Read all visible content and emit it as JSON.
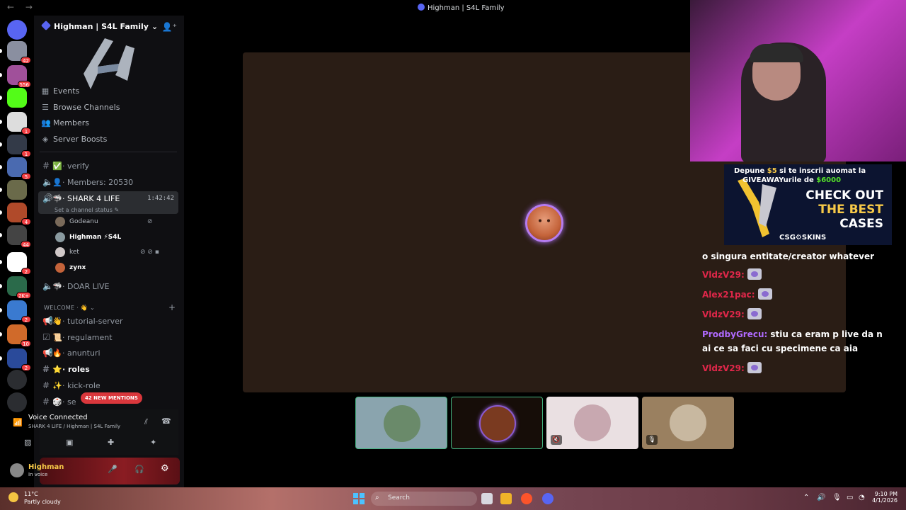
{
  "window": {
    "title": "Highman | S4L Family",
    "nav": "←  →"
  },
  "rail": {
    "servers": [
      {
        "name": "discord-home",
        "color": "#5865f2"
      },
      {
        "name": "s4l",
        "color": "#8a8fa0",
        "badge": "42"
      },
      {
        "name": "server-556",
        "color": "#a0509a",
        "badge": "556"
      },
      {
        "name": "kick",
        "color": "#53fc18"
      },
      {
        "name": "server-c",
        "color": "#dddddd",
        "badge": "1"
      },
      {
        "name": "csgo-skins",
        "color": "#333a48",
        "badge": "1"
      },
      {
        "name": "server-6",
        "color": "#4a6ab0",
        "badge": "5"
      },
      {
        "name": "server-7",
        "color": "#6a6a4a"
      },
      {
        "name": "server-8",
        "color": "#b04a2a",
        "badge": "4"
      },
      {
        "name": "server-9",
        "color": "#444444",
        "badge": "44"
      },
      {
        "name": "server-w",
        "color": "#ffffff",
        "badge": "2"
      },
      {
        "name": "server-11",
        "color": "#2a6a4a",
        "badge": "2K+"
      },
      {
        "name": "server-12",
        "color": "#3a7ad0",
        "badge": "2"
      },
      {
        "name": "server-13",
        "color": "#d06a2a",
        "badge": "10"
      },
      {
        "name": "server-14",
        "color": "#2a4a9a",
        "badge": "2"
      },
      {
        "name": "add-server",
        "color": "#2b2d31"
      },
      {
        "name": "discover",
        "color": "#2b2d31"
      }
    ]
  },
  "sidebar": {
    "server_name": "Highman | S4L Family",
    "menu": [
      {
        "label": "Events",
        "icon": "calendar-icon"
      },
      {
        "label": "Browse Channels",
        "icon": "browse-icon"
      },
      {
        "label": "Members",
        "icon": "members-icon"
      },
      {
        "label": "Server Boosts",
        "icon": "boost-icon"
      }
    ],
    "channels": {
      "verify": "· verify",
      "members": "· Members: 20530",
      "shark": "· SHARK 4 LIFE",
      "shark_timer": "1:42:42",
      "shark_status": "Set a channel status ✎",
      "doar_live": "· DOAR LIVE"
    },
    "voice_users": [
      {
        "name": "Godeanu",
        "color": "#7a6a5a"
      },
      {
        "name": "Highman ⚡S4L",
        "color": "#8a9aa0"
      },
      {
        "name": "ket",
        "color": "#d0c8c8"
      },
      {
        "name": "zynx",
        "color": "#c4633a"
      }
    ],
    "category": "WELCOME · 👋 ⌄",
    "welcome_channels": [
      {
        "label": "· tutorial-server",
        "emoji": "👋"
      },
      {
        "label": "· regulament",
        "emoji": "📜"
      },
      {
        "label": "· anunturi",
        "emoji": "🔥"
      },
      {
        "label": "· roles",
        "emoji": "⭐"
      },
      {
        "label": "· kick-role",
        "emoji": "✨"
      },
      {
        "label": "· se",
        "emoji": "🎲"
      }
    ],
    "mentions_pill": "42 NEW MENTIONS"
  },
  "voice_panel": {
    "title": "Voice Connected",
    "subtitle": "SHARK 4 LIFE / Highman | S4L Family"
  },
  "user_panel": {
    "name": "Highman",
    "status": "In voice"
  },
  "ad": {
    "line1_a": "Depune ",
    "line1_amount": "$5",
    "line1_b": " si te inscrii auomat la",
    "line2_a": "GIVEAWAYurile de ",
    "line2_amount": "$6000",
    "cta1": "CHECK OUT",
    "cta2": "THE BEST",
    "cta3": "CASES",
    "brand": "CSG⚙SKINS"
  },
  "chat": {
    "messages": [
      {
        "nick": "",
        "nick_color": "#ffffff",
        "text": "o singura entitate/creator whatever",
        "emote": false
      },
      {
        "nick": "VldzV29:",
        "nick_color": "#e0274a",
        "text": "",
        "emote": true
      },
      {
        "nick": "Alex21pac:",
        "nick_color": "#e0274a",
        "text": "",
        "emote": true
      },
      {
        "nick": "VldzV29:",
        "nick_color": "#e0274a",
        "text": "",
        "emote": true
      },
      {
        "nick": "ProdbyGrecu:",
        "nick_color": "#b06aff",
        "text": "stiu ca eram p live da n",
        "emote": false
      },
      {
        "nick": "",
        "nick_color": "#ffffff",
        "text": "ai ce sa faci cu specimene ca aia",
        "emote": false
      },
      {
        "nick": "VldzV29:",
        "nick_color": "#e0274a",
        "text": "",
        "emote": true
      }
    ]
  },
  "tiles": [
    {
      "name": "tile-godeanu",
      "bg": "#8aa4ae",
      "avatar": "#6a8a6a",
      "border": "#43b581",
      "icon": ""
    },
    {
      "name": "tile-zynx",
      "bg": "#160d08",
      "avatar": "#7a3a20",
      "border": "#43b581",
      "icon": ""
    },
    {
      "name": "tile-ket",
      "bg": "#eae0e2",
      "avatar": "#c8a8b0",
      "border": "",
      "icon": "🔇"
    },
    {
      "name": "tile-highman",
      "bg": "#9a8060",
      "avatar": "#c8b8a0",
      "border": "",
      "icon": "🎙"
    }
  ],
  "taskbar": {
    "temp": "11°C",
    "condition": "Partly cloudy",
    "search": "Search",
    "time": "9:10 PM",
    "date": "4/1/2026"
  }
}
